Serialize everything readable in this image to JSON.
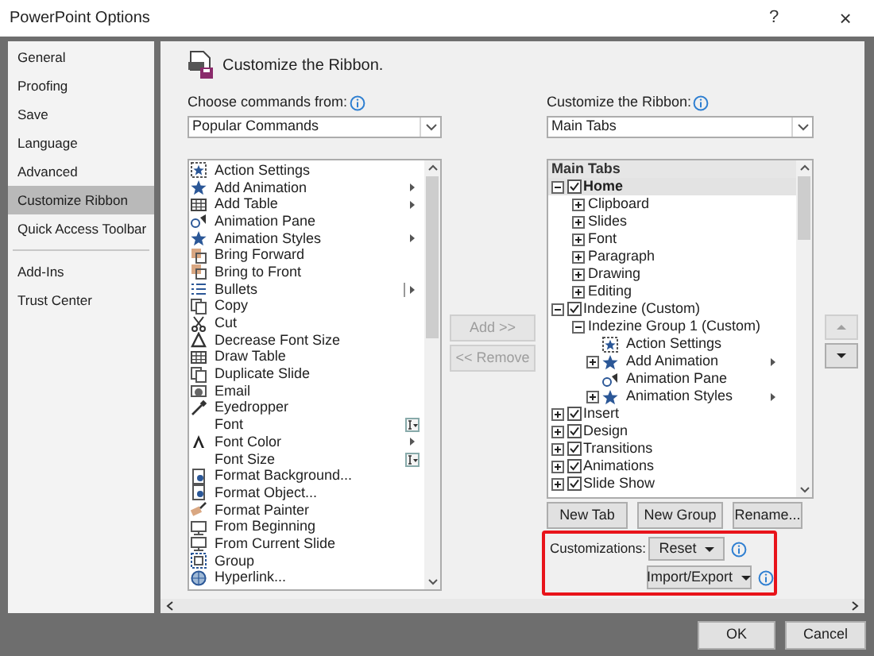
{
  "window": {
    "title": "PowerPoint Options",
    "help": "?",
    "close": "×"
  },
  "sidebar": {
    "groups": [
      {
        "items": [
          {
            "label": "General",
            "selected": false
          },
          {
            "label": "Proofing",
            "selected": false
          },
          {
            "label": "Save",
            "selected": false
          },
          {
            "label": "Language",
            "selected": false
          },
          {
            "label": "Advanced",
            "selected": false
          },
          {
            "label": "Customize Ribbon",
            "selected": true
          },
          {
            "label": "Quick Access Toolbar",
            "selected": false
          }
        ]
      },
      {
        "items": [
          {
            "label": "Add-Ins",
            "selected": false
          },
          {
            "label": "Trust Center",
            "selected": false
          }
        ]
      }
    ]
  },
  "header": {
    "title": "Customize the Ribbon."
  },
  "commands": {
    "label": "Choose commands from:",
    "dropdown": {
      "value": "Popular Commands"
    },
    "items": [
      {
        "label": "Action Settings",
        "kind": "plain"
      },
      {
        "label": "Add Animation",
        "kind": "submenu"
      },
      {
        "label": "Add Table",
        "kind": "submenu"
      },
      {
        "label": "Animation Pane",
        "kind": "plain"
      },
      {
        "label": "Animation Styles",
        "kind": "submenu"
      },
      {
        "label": "Bring Forward",
        "kind": "plain"
      },
      {
        "label": "Bring to Front",
        "kind": "plain"
      },
      {
        "label": "Bullets",
        "kind": "split"
      },
      {
        "label": "Copy",
        "kind": "plain"
      },
      {
        "label": "Cut",
        "kind": "plain"
      },
      {
        "label": "Decrease Font Size",
        "kind": "plain"
      },
      {
        "label": "Draw Table",
        "kind": "plain"
      },
      {
        "label": "Duplicate Slide",
        "kind": "plain"
      },
      {
        "label": "Email",
        "kind": "plain"
      },
      {
        "label": "Eyedropper",
        "kind": "plain"
      },
      {
        "label": "Font",
        "kind": "field"
      },
      {
        "label": "Font Color",
        "kind": "submenu"
      },
      {
        "label": "Font Size",
        "kind": "field"
      },
      {
        "label": "Format Background...",
        "kind": "plain"
      },
      {
        "label": "Format Object...",
        "kind": "plain"
      },
      {
        "label": "Format Painter",
        "kind": "plain"
      },
      {
        "label": "From Beginning",
        "kind": "plain"
      },
      {
        "label": "From Current Slide",
        "kind": "plain"
      },
      {
        "label": "Group",
        "kind": "plain"
      },
      {
        "label": "Hyperlink...",
        "kind": "plain"
      }
    ]
  },
  "add_button": {
    "label": "Add >>",
    "disabled": true
  },
  "remove_button": {
    "label": "<< Remove",
    "disabled": true
  },
  "ribbon": {
    "label": "Customize the Ribbon:",
    "dropdown": {
      "value": "Main Tabs"
    },
    "tree": {
      "header": "Main Tabs",
      "items": [
        {
          "label": "Home",
          "kind": "tab",
          "checked": true,
          "expanded": true,
          "selected": true,
          "children": [
            {
              "label": "Clipboard",
              "kind": "group",
              "expanded": false,
              "selected": false
            },
            {
              "label": "Slides",
              "kind": "group",
              "expanded": false,
              "selected": false
            },
            {
              "label": "Font",
              "kind": "group",
              "expanded": false,
              "selected": false
            },
            {
              "label": "Paragraph",
              "kind": "group",
              "expanded": false,
              "selected": false
            },
            {
              "label": "Drawing",
              "kind": "group",
              "expanded": false,
              "selected": false
            },
            {
              "label": "Editing",
              "kind": "group",
              "expanded": false,
              "selected": false
            }
          ]
        },
        {
          "label": "Indezine (Custom)",
          "kind": "tab",
          "checked": true,
          "expanded": true,
          "selected": false,
          "children": [
            {
              "label": "Indezine Group 1 (Custom)",
              "kind": "group",
              "expanded": true,
              "selected": false,
              "children": [
                {
                  "label": "Action Settings",
                  "kind": "command",
                  "selected": false
                },
                {
                  "label": "Add Animation",
                  "kind": "command",
                  "expanded": false,
                  "submenu": true,
                  "selected": false
                },
                {
                  "label": "Animation Pane",
                  "kind": "command",
                  "selected": false
                },
                {
                  "label": "Animation Styles",
                  "kind": "command",
                  "expanded": false,
                  "submenu": true,
                  "selected": false
                }
              ]
            }
          ]
        },
        {
          "label": "Insert",
          "kind": "tab",
          "checked": true,
          "expanded": false,
          "selected": false
        },
        {
          "label": "Design",
          "kind": "tab",
          "checked": true,
          "expanded": false,
          "selected": false
        },
        {
          "label": "Transitions",
          "kind": "tab",
          "checked": true,
          "expanded": false,
          "selected": false
        },
        {
          "label": "Animations",
          "kind": "tab",
          "checked": true,
          "expanded": false,
          "selected": false
        },
        {
          "label": "Slide Show",
          "kind": "tab",
          "checked": true,
          "expanded": false,
          "selected": false
        }
      ]
    }
  },
  "move_up_button": {
    "disabled": true
  },
  "move_down_button": {
    "disabled": false
  },
  "tree_buttons": [
    "New Tab",
    "New Group",
    "Rename..."
  ],
  "customizations": {
    "label": "Customizations:",
    "highlighted": true,
    "buttons": [
      "Reset",
      "Import/Export"
    ]
  },
  "footer": {
    "buttons": [
      "OK",
      "Cancel"
    ]
  }
}
